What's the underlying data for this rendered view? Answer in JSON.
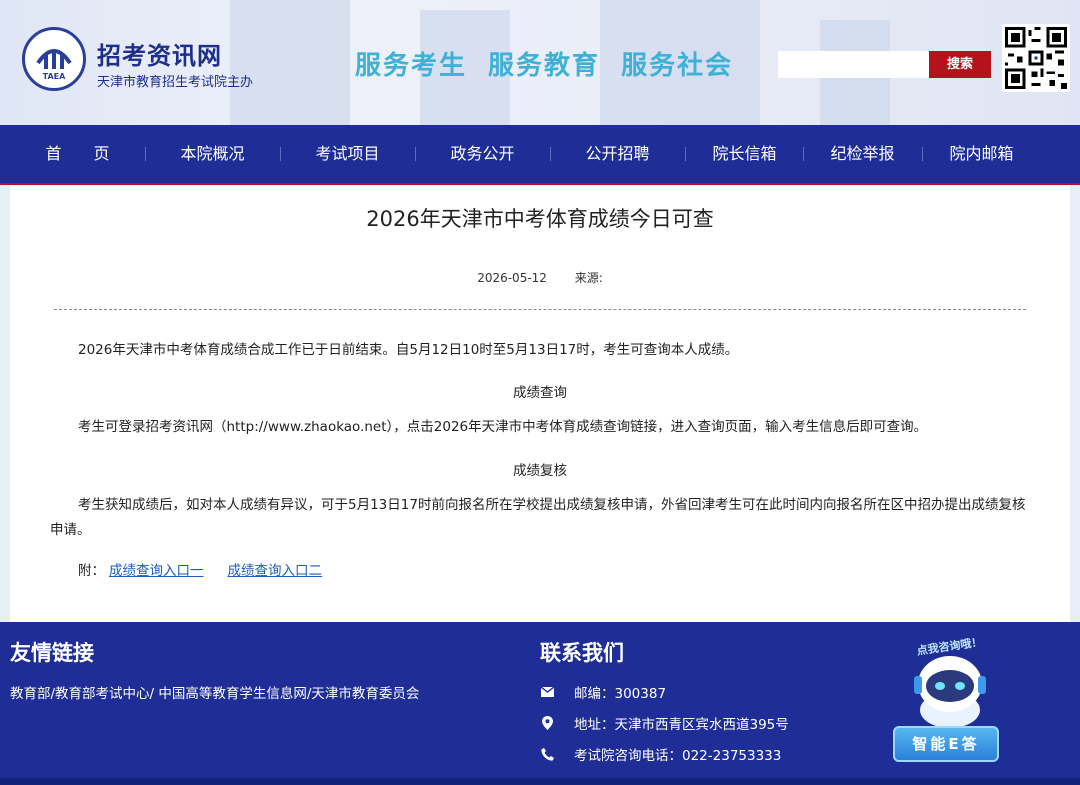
{
  "header": {
    "site_name": "招考资讯网",
    "site_sub": "天津市教育招生考试院主办",
    "logo_text": "TAEA",
    "slogan": "服务考生  服务教育  服务社会",
    "search_placeholder": "",
    "search_label": "搜索"
  },
  "nav": {
    "items": [
      "首　　页",
      "本院概况",
      "考试项目",
      "政务公开",
      "公开招聘",
      "院长信箱",
      "纪检举报",
      "院内邮箱"
    ]
  },
  "article": {
    "title": "2026年天津市中考体育成绩今日可查",
    "date": "2026-05-12",
    "source_label": "来源:",
    "p1": "2026年天津市中考体育成绩合成工作已于日前结束。自5月12日10时至5月13日17时，考生可查询本人成绩。",
    "h1": "成绩查询",
    "p2": "考生可登录招考资讯网（http://www.zhaokao.net），点击2026年天津市中考体育成绩查询链接，进入查询页面，输入考生信息后即可查询。",
    "h2": "成绩复核",
    "p3": "考生获知成绩后，如对本人成绩有异议，可于5月13日17时前向报名所在学校提出成绩复核申请，外省回津考生可在此时间内向报名所在区中招办提出成绩复核申请。",
    "attach_label": "附：",
    "link1": "成绩查询入口一",
    "link2": "成绩查询入口二"
  },
  "footer": {
    "links_title": "友情链接",
    "links_text": "教育部/教育部考试中心/ 中国高等教育学生信息网/天津市教育委员会",
    "contact_title": "联系我们",
    "postcode": "邮编：300387",
    "address": "地址：天津市西青区宾水西道395号",
    "phone": "考试院咨询电话：022-23753333",
    "robot_banner": "点我咨询哦！",
    "ai_label": "智能E答"
  },
  "colors": {
    "nav_bg": "#1f2e96",
    "accent_red": "#b5121b",
    "slogan": "#3fb0d6",
    "link": "#1b5dbb"
  },
  "icons": [
    "mail-icon",
    "location-icon",
    "phone-icon",
    "qr-code"
  ]
}
